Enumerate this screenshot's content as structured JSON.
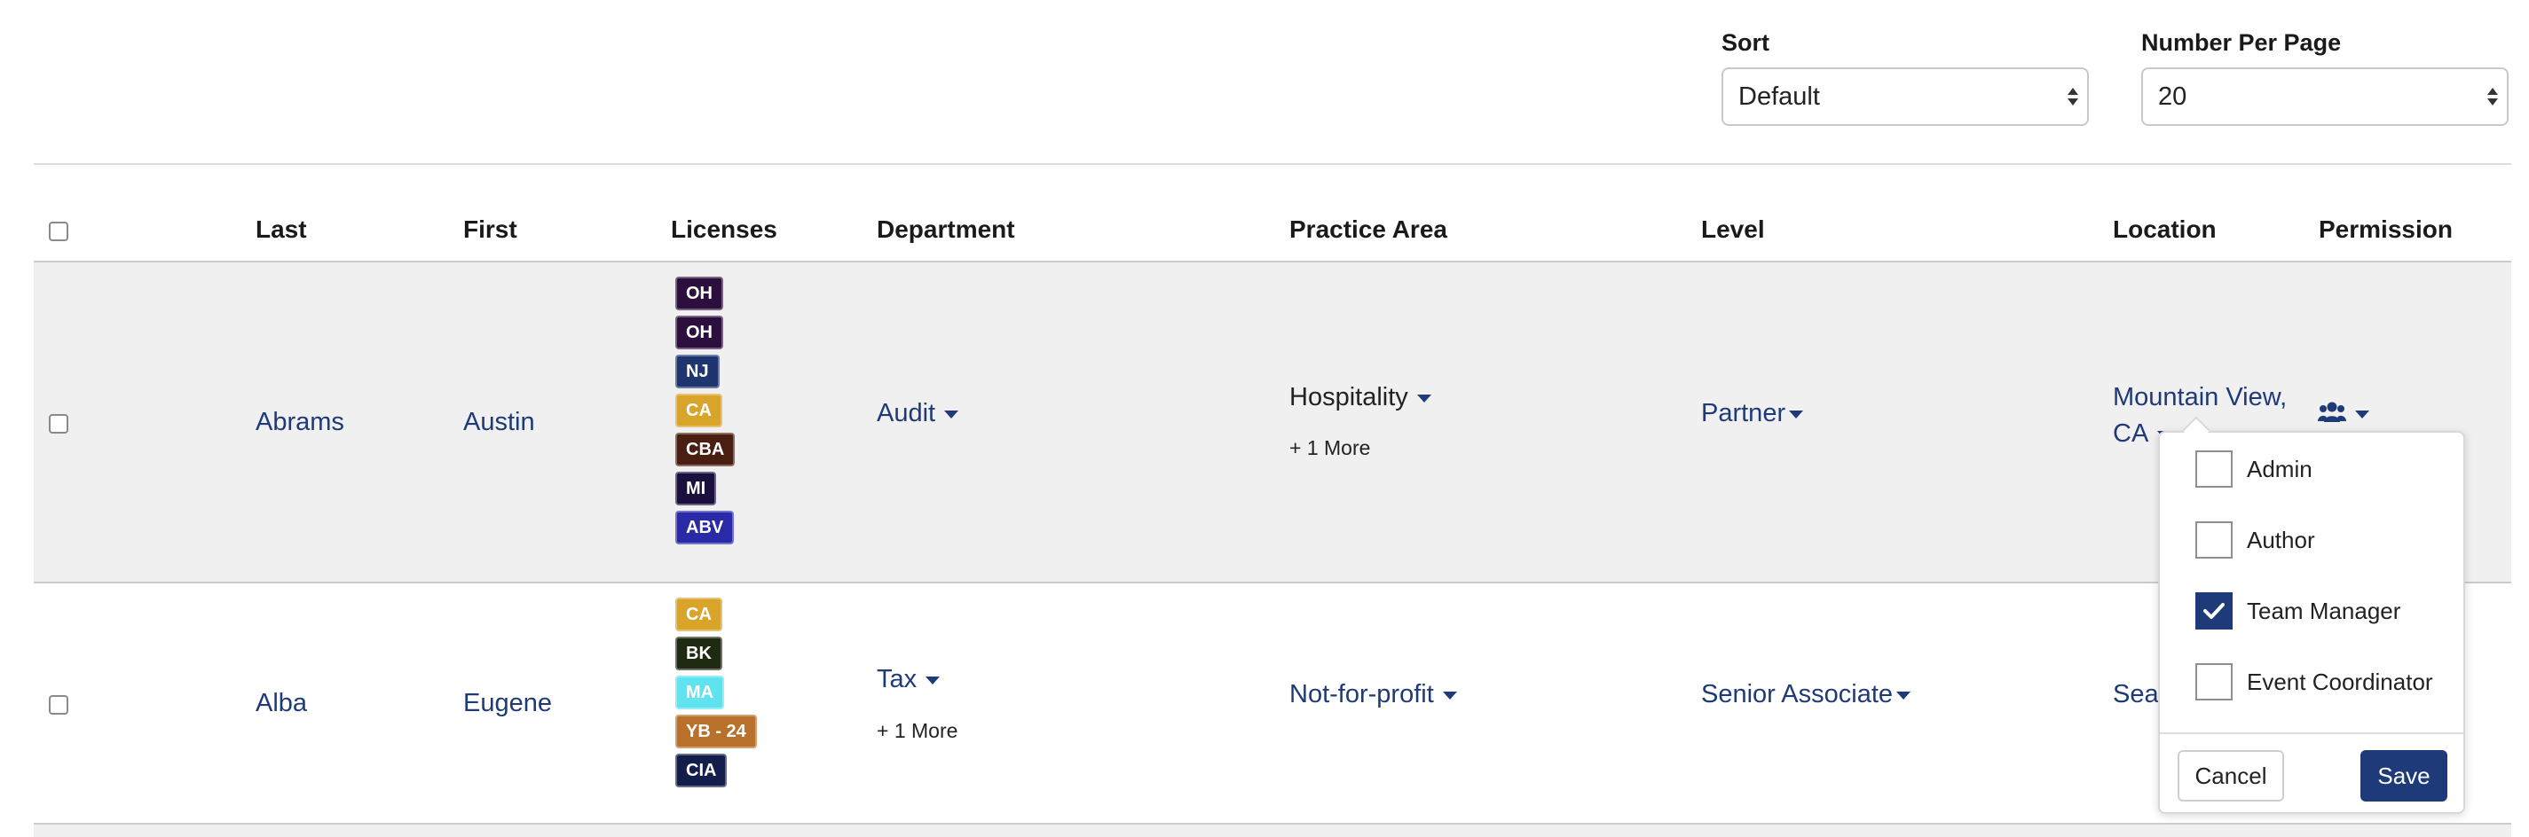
{
  "controls": {
    "sort_label": "Sort",
    "sort_value": "Default",
    "per_page_label": "Number Per Page",
    "per_page_value": "20"
  },
  "table": {
    "headers": {
      "last": "Last",
      "first": "First",
      "licenses": "Licenses",
      "department": "Department",
      "practice_area": "Practice Area",
      "level": "Level",
      "location": "Location",
      "permission": "Permission"
    },
    "rows": [
      {
        "last": "Abrams",
        "first": "Austin",
        "licenses": [
          {
            "code": "OH",
            "color": "#2d0f3e"
          },
          {
            "code": "OH",
            "color": "#2d0f3e"
          },
          {
            "code": "NJ",
            "color": "#1e3570"
          },
          {
            "code": "CA",
            "color": "#d9a42a"
          },
          {
            "code": "CBA",
            "color": "#4a1e10"
          },
          {
            "code": "MI",
            "color": "#1a0f3d"
          },
          {
            "code": "ABV",
            "color": "#2a2aa8"
          }
        ],
        "department": "Audit",
        "department_more": "",
        "practice_area": "Hospitality",
        "practice_more": "+ 1 More",
        "level": "Partner",
        "location_line1": "Mountain View,",
        "location_line2": "CA"
      },
      {
        "last": "Alba",
        "first": "Eugene",
        "licenses": [
          {
            "code": "CA",
            "color": "#d9a42a"
          },
          {
            "code": "BK",
            "color": "#1e2a12"
          },
          {
            "code": "MA",
            "color": "#5fe3ee"
          },
          {
            "code": "YB - 24",
            "color": "#b8702a"
          },
          {
            "code": "CIA",
            "color": "#141e4a"
          }
        ],
        "department": "Tax",
        "department_more": "+ 1 More",
        "practice_area": "Not-for-profit",
        "practice_more": "",
        "level": "Senior Associate",
        "location_partial": "Seat"
      }
    ]
  },
  "permission_popup": {
    "options": [
      {
        "label": "Admin",
        "checked": false
      },
      {
        "label": "Author",
        "checked": false
      },
      {
        "label": "Team Manager",
        "checked": true
      },
      {
        "label": "Event Coordinator",
        "checked": false
      }
    ],
    "cancel_label": "Cancel",
    "save_label": "Save"
  },
  "icons": {
    "permission": "users-icon",
    "dropdown": "caret-down-icon",
    "check": "checkmark-icon"
  },
  "colors": {
    "accent": "#1f3a78",
    "row_shade": "#f0f0f0"
  }
}
